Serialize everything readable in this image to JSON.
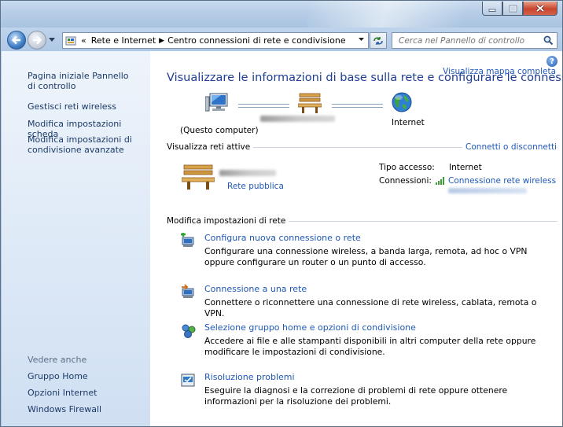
{
  "window": {
    "controls": {
      "minimize_icon": "minimize-icon",
      "maximize_icon": "maximize-icon",
      "close_icon": "close-icon"
    }
  },
  "address_bar": {
    "overflow": "«",
    "crumbs": [
      "Rete e Internet",
      "Centro connessioni di rete e condivisione"
    ],
    "search_placeholder": "Cerca nel Pannello di controllo"
  },
  "sidebar": {
    "links": [
      "Pagina iniziale Pannello di controllo",
      "Gestisci reti wireless",
      "Modifica impostazioni scheda",
      "Modifica impostazioni di condivisione avanzate"
    ],
    "see_also_label": "Vedere anche",
    "see_also": [
      "Gruppo Home",
      "Opzioni Internet",
      "Windows Firewall"
    ]
  },
  "main": {
    "heading": "Visualizzare le informazioni di base sulla rete e configurare le connessioni",
    "full_map_link": "Visualizza mappa completa",
    "map": {
      "computer_label": "(Questo computer)",
      "internet_label": "Internet"
    },
    "active_networks_label": "Visualizza reti attive",
    "connect_link": "Connetti o disconnetti",
    "network": {
      "type_link": "Rete pubblica",
      "access_type_label": "Tipo accesso:",
      "access_type_value": "Internet",
      "connections_label": "Connessioni:",
      "connection_link": "Connessione rete wireless"
    },
    "change_settings_label": "Modifica impostazioni di rete",
    "tasks": [
      {
        "title": "Configura nuova connessione o rete",
        "desc": "Configurare una connessione wireless, a banda larga, remota, ad hoc o VPN oppure configurare un router o un punto di accesso.",
        "icon": "new-connection-icon"
      },
      {
        "title": "Connessione a una rete",
        "desc": "Connettere o riconnettere una connessione di rete wireless, cablata, remota o VPN.",
        "icon": "connect-network-icon"
      },
      {
        "title": "Selezione gruppo home e opzioni di condivisione",
        "desc": "Accedere ai file e alle stampanti disponibili in altri computer della rete oppure modificare le impostazioni di condivisione.",
        "icon": "homegroup-icon"
      },
      {
        "title": "Risoluzione problemi",
        "desc": "Eseguire la diagnosi e la correzione di problemi di rete oppure ottenere informazioni per la risoluzione dei problemi.",
        "icon": "troubleshoot-icon"
      }
    ]
  }
}
